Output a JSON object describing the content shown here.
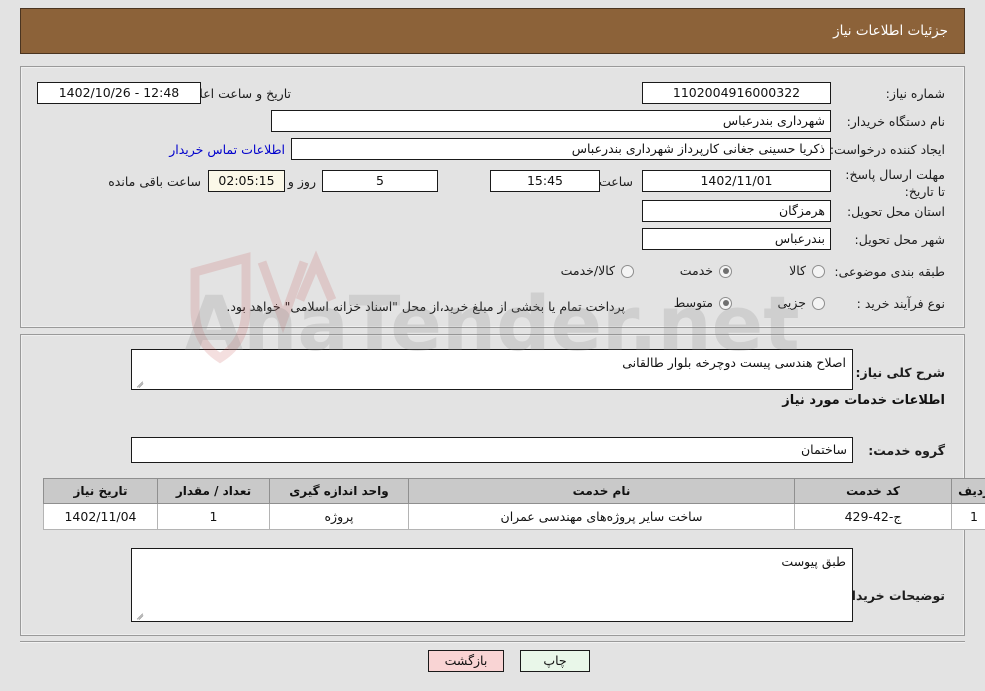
{
  "header": {
    "title": "جزئیات اطلاعات نیاز"
  },
  "top_section": {
    "need_number_label": "شماره نیاز:",
    "need_number_value": "1102004916000322",
    "announce_label": "تاریخ و ساعت اعلان عمومی:",
    "announce_value": "12:48 - 1402/10/26",
    "buyer_org_label": "نام دستگاه خریدار:",
    "buyer_org_value": "شهرداری بندرعباس",
    "creator_label": "ایجاد کننده درخواست:",
    "creator_value": "ذکریا حسینی جغانی کارپرداز شهرداری بندرعباس",
    "contact_link": "اطلاعات تماس خریدار",
    "deadline_label": "مهلت ارسال پاسخ: تا تاریخ:",
    "deadline_date": "1402/11/01",
    "hour_label": "ساعت",
    "deadline_time": "15:45",
    "days_left": "5",
    "days_and_label": "روز و",
    "time_left": "02:05:15",
    "hours_remaining_label": "ساعت باقی مانده",
    "province_label": "استان محل تحویل:",
    "province_value": "هرمزگان",
    "city_label": "شهر محل تحویل:",
    "city_value": "بندرعباس",
    "category_label": "طبقه بندی موضوعی:",
    "category_options": [
      {
        "label": "کالا",
        "selected": false
      },
      {
        "label": "خدمت",
        "selected": true
      },
      {
        "label": "کالا/خدمت",
        "selected": false
      }
    ],
    "process_label": "نوع فرآیند خرید :",
    "process_options": [
      {
        "label": "جزیی",
        "selected": false
      },
      {
        "label": "متوسط",
        "selected": true
      }
    ],
    "payment_note": "پرداخت تمام یا بخشی از مبلغ خرید،از محل \"اسناد خزانه اسلامی\" خواهد بود."
  },
  "mid_section": {
    "general_desc_label": "شرح کلی نیاز:",
    "general_desc_value": "اصلاح هندسی پیست دوچرخه بلوار طالقانی",
    "services_info_heading": "اطلاعات خدمات مورد نیاز",
    "service_group_label": "گروه خدمت:",
    "service_group_value": "ساختمان",
    "buyer_notes_label": "توضیحات خریدار:",
    "buyer_notes_value": "طبق پیوست"
  },
  "table": {
    "columns": [
      "ردیف",
      "کد خدمت",
      "نام خدمت",
      "واحد اندازه گیری",
      "تعداد / مقدار",
      "تاریخ نیاز"
    ],
    "rows": [
      {
        "row": "1",
        "code": "ج-42-429",
        "name": "ساخت سایر پروژه‌های مهندسی عمران",
        "unit": "پروژه",
        "qty": "1",
        "date": "1402/11/04"
      }
    ]
  },
  "footer": {
    "print_label": "چاپ",
    "back_label": "بازگشت"
  },
  "watermark": {
    "text": "AnaTender.net"
  },
  "colors": {
    "header_bg": "#8c6239",
    "page_bg": "#e3e3e3",
    "link": "#0000cc",
    "back_btn": "#f9d4d4",
    "print_btn": "#e9f7e9",
    "table_header": "#c9c9c9"
  }
}
